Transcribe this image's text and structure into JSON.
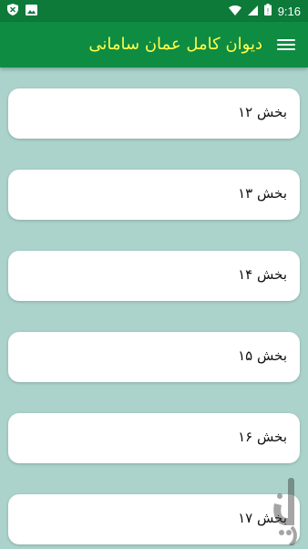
{
  "status_bar": {
    "time": "9:16",
    "icons": [
      "shield-notification-icon",
      "image-notification-icon",
      "wifi-icon",
      "signal-icon",
      "battery-icon"
    ]
  },
  "app_bar": {
    "title": "دیوان کامل عمان سامانی",
    "menu_icon": "hamburger-menu-icon"
  },
  "colors": {
    "status_bar": "#0d7a3a",
    "app_bar": "#0e8c42",
    "title": "#ffff4d",
    "background": "#abd3cc",
    "card": "#ffffff"
  },
  "sections": [
    {
      "label": "بخش ۱۲"
    },
    {
      "label": "بخش ۱۳"
    },
    {
      "label": "بخش ۱۴"
    },
    {
      "label": "بخش ۱۵"
    },
    {
      "label": "بخش ۱۶"
    },
    {
      "label": "بخش ۱۷"
    }
  ]
}
